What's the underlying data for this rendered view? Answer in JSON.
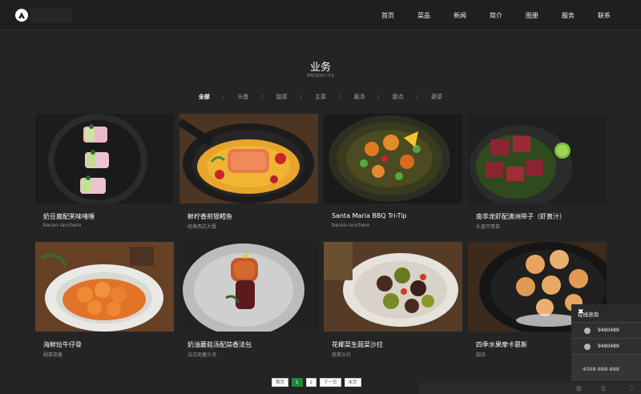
{
  "nav": {
    "items": [
      "首页",
      "菜品",
      "新闻",
      "简介",
      "图册",
      "服务",
      "联系"
    ]
  },
  "section": {
    "title": "业务",
    "subtitle": "PRODUCTS"
  },
  "categories": [
    "全部",
    "头盘",
    "副菜",
    "主菜",
    "酱汤",
    "甜点",
    "蔬菜"
  ],
  "active_category": "全部",
  "products": [
    {
      "name": "奶豆腐配芙味啫喱",
      "sub": "bacon-ranchero",
      "icon": "sushi-plate-icon"
    },
    {
      "name": "鲜柠香煎银鳕鱼",
      "sub": "经典西式大餐",
      "icon": "salmon-pan-icon"
    },
    {
      "name": "Santa Maria BBQ Tri-Tip",
      "sub": "bacon-ranchero",
      "icon": "vegetable-plate-icon"
    },
    {
      "name": "南非龙虾配澳洲带子（虾黄汁）",
      "sub": "头盘开胃菜",
      "icon": "beef-cubes-icon"
    },
    {
      "name": "海鲜烩牛仔骨",
      "sub": "副菜菜着",
      "icon": "shrimp-dish-icon"
    },
    {
      "name": "奶油蘑菇汤配蒜香法包",
      "sub": "法式局塞头汤",
      "icon": "tower-dessert-icon"
    },
    {
      "name": "花椰菜生蔬菜沙拉",
      "sub": "蔬菜沙拉",
      "icon": "olive-bowl-icon"
    },
    {
      "name": "四季水果摩卡慕斯",
      "sub": "甜品",
      "icon": "scallop-plate-icon"
    }
  ],
  "pager": [
    "首页",
    "1",
    "2",
    "下一页",
    "末页"
  ],
  "pager_active": "1",
  "consult": {
    "title": "在线咨询",
    "close": "✖",
    "qq": [
      "9490489",
      "9490489"
    ],
    "phone": "4008-888-888"
  },
  "colors": {
    "background": "#242424",
    "header": "#1f1f1f",
    "accent": "#1d8a3a"
  }
}
